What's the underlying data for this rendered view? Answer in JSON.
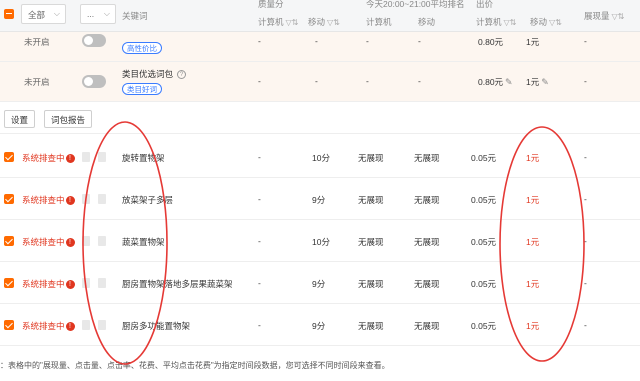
{
  "header": {
    "filter_all": "全部",
    "filter_more": "...",
    "keyword_col": "关键词",
    "quality_col": "质量分",
    "period_col": "今天20:00~21:00平均排名",
    "bid_col": "出价",
    "sub_pc": "计算机",
    "sub_mobile": "移动",
    "impressions_col": "展现量"
  },
  "category_rows": [
    {
      "status": "未开启",
      "title": "",
      "tag": "高性价比",
      "quality": "-",
      "q_mobile": "-",
      "rank_pc": "-",
      "rank_mobile": "-",
      "bid_pc": "0.80元",
      "bid_mobile": "1元",
      "impressions": "-"
    },
    {
      "status": "未开启",
      "title": "类目优选词包",
      "tag": "类目好词",
      "quality": "-",
      "q_mobile": "-",
      "rank_pc": "-",
      "rank_mobile": "-",
      "bid_pc": "0.80元",
      "bid_mobile": "1元",
      "impressions": "-"
    }
  ],
  "toolbar": {
    "settings": "设置",
    "report": "词包报告"
  },
  "rows": [
    {
      "status": "系统排查中",
      "keyword": "旋转置物架",
      "quality_pc": "-",
      "quality_mobile": "10分",
      "rank_pc": "无展现",
      "rank_mobile": "无展现",
      "bid_pc": "0.05元",
      "bid_mobile": "1元",
      "impressions": "-"
    },
    {
      "status": "系统排查中",
      "keyword": "放菜架子多层",
      "quality_pc": "-",
      "quality_mobile": "9分",
      "rank_pc": "无展现",
      "rank_mobile": "无展现",
      "bid_pc": "0.05元",
      "bid_mobile": "1元",
      "impressions": "-"
    },
    {
      "status": "系统排查中",
      "keyword": "蔬菜置物架",
      "quality_pc": "-",
      "quality_mobile": "10分",
      "rank_pc": "无展现",
      "rank_mobile": "无展现",
      "bid_pc": "0.05元",
      "bid_mobile": "1元",
      "impressions": "-"
    },
    {
      "status": "系统排查中",
      "keyword": "厨房置物架落地多层果蔬菜架",
      "quality_pc": "-",
      "quality_mobile": "9分",
      "rank_pc": "无展现",
      "rank_mobile": "无展现",
      "bid_pc": "0.05元",
      "bid_mobile": "1元",
      "impressions": "-"
    },
    {
      "status": "系统排查中",
      "keyword": "厨房多功能置物架",
      "quality_pc": "-",
      "quality_mobile": "9分",
      "rank_pc": "无展现",
      "rank_mobile": "无展现",
      "bid_pc": "0.05元",
      "bid_mobile": "1元",
      "impressions": "-"
    }
  ],
  "footer": "：表格中的\"展现量、点击量、点击率、花费、平均点击花费\"为指定时间段数据，您可选择不同时间段来查看。",
  "colors": {
    "accent": "#ff6a00",
    "alert": "#e0361f",
    "tag": "#3b7cff",
    "annotation": "#e53935"
  }
}
